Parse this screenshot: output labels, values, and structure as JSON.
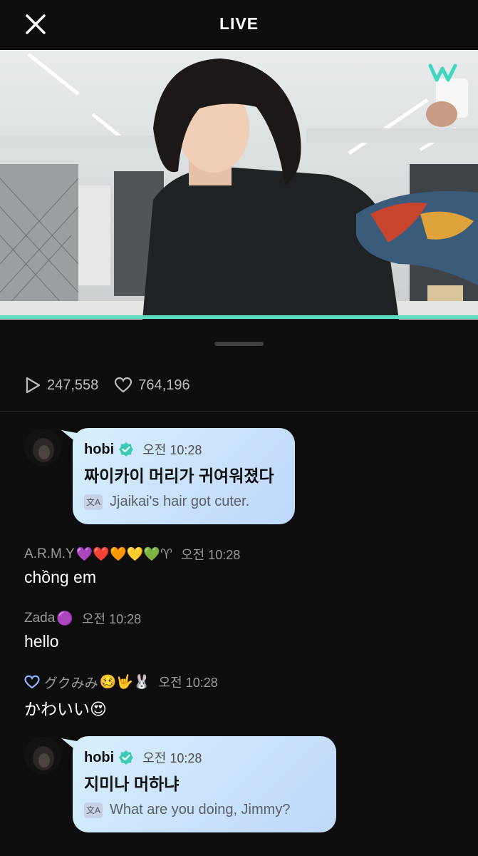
{
  "header": {
    "title": "LIVE"
  },
  "stats": {
    "views": "247,558",
    "likes": "764,196"
  },
  "messages": [
    {
      "author": "hobi",
      "time": "오전 10:28",
      "text": "짜이카이 머리가 귀여워졌다",
      "translation": "Jjaikai's hair got cuter."
    },
    {
      "author": "A.R.M.Y",
      "badges": "💜❤️🧡💛💚♈",
      "time": "오전 10:28",
      "text": "chồng em"
    },
    {
      "author": "Zada",
      "badges": "🟣",
      "time": "오전 10:28",
      "text": "hello"
    },
    {
      "author": "グクみみ",
      "badges": "🥴🤟🐰",
      "time": "오전 10:28",
      "text": "かわいい😍"
    },
    {
      "author": "hobi",
      "time": "오전 10:28",
      "text": "지미나 머하냐",
      "translation": "What are you doing, Jimmy?"
    }
  ],
  "colors": {
    "accent": "#5fe0c4",
    "bubble": "#cfe6fb",
    "background": "#0d0d0d"
  },
  "icons": [
    "close-icon",
    "play-icon",
    "heart-icon",
    "verified-icon",
    "translate-icon",
    "weverse-logo"
  ]
}
